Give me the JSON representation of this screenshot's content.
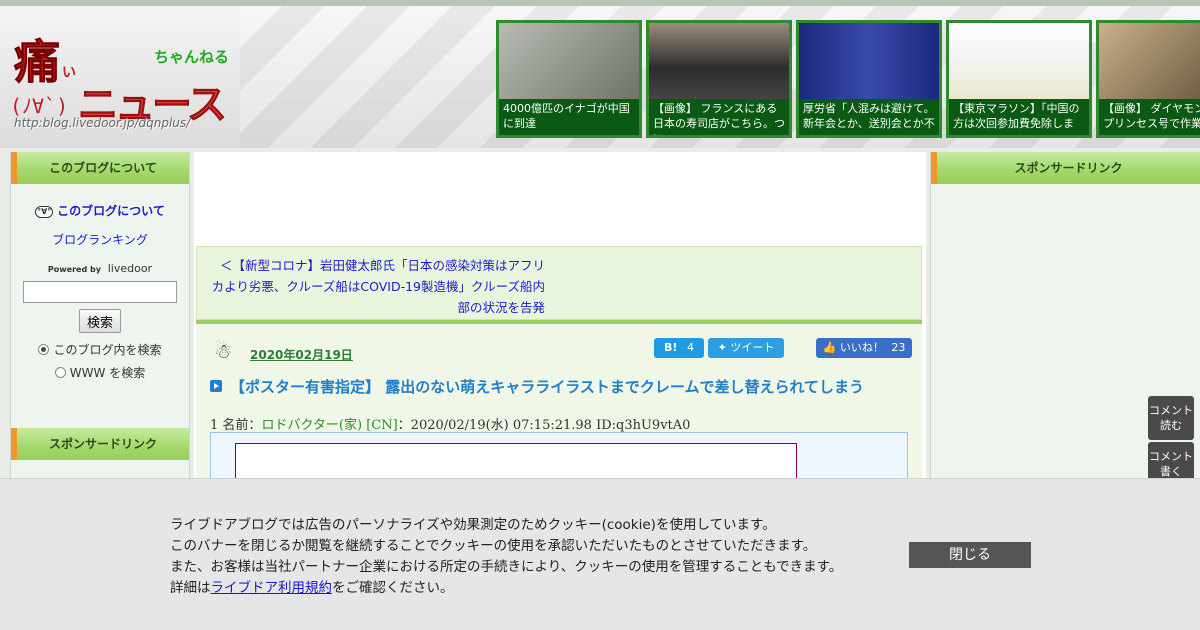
{
  "header": {
    "logo": {
      "kanji": "痛",
      "kanji_sub": "い",
      "chan": "ちゃんねる",
      "news": "ニュース",
      "face": "(ﾉ∀`)",
      "url": "http:blog.livedoor.jp/dqnplus/"
    },
    "thumbnails": [
      {
        "caption": "4000億匹のイナゴが中国に到達",
        "color": "#8a8f86"
      },
      {
        "caption": "【画像】 フランスにある日本の寿司店がこちら。つい",
        "color": "#3b3b3b"
      },
      {
        "caption": "厚労省「人混みは避けて。新年会とか、送別会とか不",
        "color": "#2a3a8a"
      },
      {
        "caption": "【東京マラソン】「中国の方は次回参加費免除しま",
        "color": "#f2f2f2"
      },
      {
        "caption": "【画像】 ダイヤモンド・プリンセス号で作業す",
        "color": "#7a6a4a"
      }
    ]
  },
  "left": {
    "about_heading": "このブログについて",
    "about_link": "このブログについて",
    "ranking_link": "ブログランキング",
    "powered_by": "Powered by",
    "livedoor": "livedoor",
    "search_button": "検索",
    "radio_blog": "このブログ内を検索",
    "radio_www": "WWW を検索",
    "sponsor_heading": "スポンサードリンク"
  },
  "center": {
    "prev_link": "＜【新型コロナ】岩田健太郎氏「日本の感染対策はアフリカより劣悪、クルーズ船はCOVID-19製造機」クルーズ船内部の状況を告発",
    "date": "2020年02月19日",
    "hatena_count": "4",
    "tweet_label": "ツイート",
    "like_label": "いいね！",
    "like_count": "23",
    "title": "【ポスター有害指定】 露出のない萌えキャラライラストまでクレームで差し替えられてしまう",
    "res_number": "1",
    "res_label": "名前：",
    "res_name": "ロドバクター(家) [CN]",
    "res_meta": "：2020/02/19(水) 07:15:21.98 ID:q3hU9vtA0"
  },
  "right": {
    "sponsor_heading": "スポンサードリンク"
  },
  "floating": {
    "read_comments": "コメント\n読む",
    "write_comments": "コメント\n書く"
  },
  "cookie": {
    "line1": "ライブドアブログでは広告のパーソナライズや効果測定のためクッキー(cookie)を使用しています。",
    "line2": "このバナーを閉じるか閲覧を継続することでクッキーの使用を承認いただいたものとさせていただきます。",
    "line3": "また、お客様は当社パートナー企業における所定の手続きにより、クッキーの使用を管理することもできます。",
    "line4_prefix": "詳細は",
    "line4_link": "ライブドア利用規約",
    "line4_suffix": "をご確認ください。",
    "close": "閉じる"
  }
}
